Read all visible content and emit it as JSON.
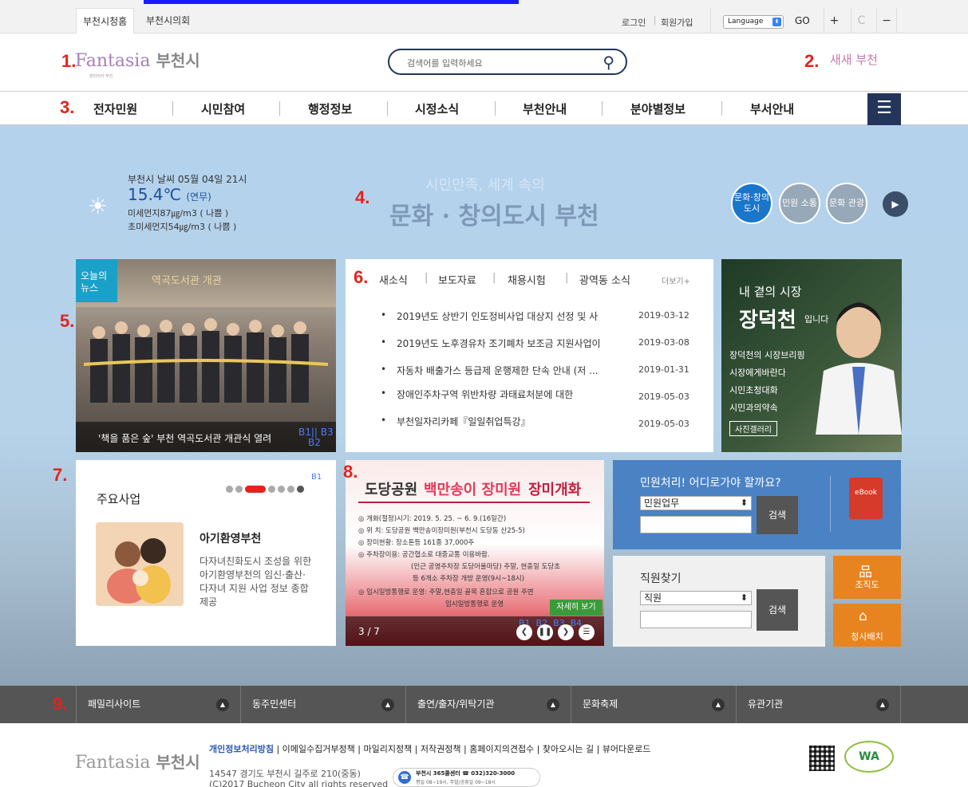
{
  "topbar": {
    "tabs": [
      "부천시청홈",
      "부천시의회"
    ],
    "login": "로그인",
    "signup": "회원가입",
    "language": "Language",
    "go": "GO",
    "zoom_in": "+",
    "reset": "C",
    "zoom_out": "−"
  },
  "markers": [
    "1.",
    "2.",
    "3.",
    "4.",
    "5.",
    "6.",
    "7.",
    "8.",
    "9."
  ],
  "header": {
    "logo": "Fantasia",
    "logo_city": "부천시",
    "logo_sub": "판타지아 부천",
    "search_placeholder": "검색어를 입력하세요",
    "slogan": "새새 부천"
  },
  "gnb": [
    "전자민원",
    "시민참여",
    "행정정보",
    "시정소식",
    "부천안내",
    "분야별정보",
    "부서안내"
  ],
  "weather": {
    "title": "부천시 날씨 05월 04일 21시",
    "temp": "15.4℃",
    "cond": "(연무)",
    "pm10": "미세먼지87㎍/m3 ( 나쁨 )",
    "pm25": "초미세먼지54㎍/m3 ( 나쁨 )"
  },
  "hero": {
    "slogan_small": "시민만족, 세계 속의",
    "slogan_big": "문화 · 창의도시 부천",
    "circles": [
      "문화·창의 도시",
      "민원 소통",
      "문화 관광"
    ]
  },
  "news_photo": {
    "badge": "오늘의 뉴스",
    "sign": "역곡도서관 개관",
    "caption": "'책을 품은 숲' 부천 역곡도서관 개관식 열려",
    "buttons": "B1|| B3",
    "buttons2": "B2"
  },
  "news_list": {
    "tabs": [
      "새소식",
      "보도자료",
      "채용시험",
      "광역동 소식"
    ],
    "more": "더보기+",
    "items": [
      {
        "title": "2019년도 상반기 인도정비사업 대상지 선정 및 사",
        "date": "2019-03-12"
      },
      {
        "title": "2019년도 노후경유차 조기폐차 보조금 지원사업이",
        "date": "2019-03-08"
      },
      {
        "title": "자동차 배출가스 등급제 운행제한 단속 안내 (저 ...",
        "date": "2019-01-31"
      },
      {
        "title": "장애인주차구역 위반차량 과태료처분에 대한",
        "date": "2019-05-03"
      },
      {
        "title": "부천일자리카페『일일취업특강』",
        "date": "2019-05-03"
      }
    ]
  },
  "mayor": {
    "line1": "내 곁의 시장",
    "line2": "장덕천",
    "line2b": "입니다",
    "links": [
      "장덕천의 시장브리핑",
      "시장에게바란다",
      "시민초청대화",
      "시민과의약속"
    ],
    "gallery": "사진갤러리"
  },
  "business": {
    "title": "주요사업",
    "sub": "아기환영부천",
    "desc": [
      "다자녀친화도시 조성을 위한",
      "아기환영부천의 임신·출산·",
      "다자녀 지원 사업 정보 종합",
      "제공"
    ],
    "label": "B1"
  },
  "rose": {
    "title": "도당공원",
    "title2": "백만송이 장미원",
    "title3": "장미개화",
    "lines": [
      "◎ 개화(절정)시기: 2019. 5. 25. ~ 6. 9.(16일간)",
      "◎ 위 치: 도당공원 백만송이장미원(부천시 도당동 산25-5)",
      "◎ 장미현황: 장소톤등 161종 37,000주",
      "◎ 주차장이용: 공간협소로 대중교통 이용바람.",
      "(인근 공영주차장 도당어울마당) 주말, 현충일 도당초",
      "등 6개소 주차장 개방 운영(9시~18시)",
      "◎ 임시일방통행로 운영: 주말,현충일 골목 혼잡으로 공원 주변",
      "임시일방통행로 운영"
    ],
    "detail": "자세히 보기",
    "page": "3 / 7",
    "blabels": "B1  B2  B3  B4"
  },
  "civil": {
    "title": "민원처리! 어디로가야 할까요?",
    "select": "민원업무",
    "btn": "검색",
    "ebook": "eBook"
  },
  "staff": {
    "title": "직원찾기",
    "select": "직원",
    "btn": "검색",
    "org": "조직도",
    "office": "청사배치"
  },
  "footbar": [
    "패밀리사이트",
    "동주민센터",
    "출연/출자/위탁기관",
    "문화축제",
    "유관기관"
  ],
  "footer": {
    "links": [
      "개인정보처리방침",
      "이메일수집거부정책",
      "마일리지정책",
      "저작권정책",
      "홈페이지의견접수",
      "찾아오시는 길",
      "뷰어다운로드"
    ],
    "address": "14547 경기도 부천시 길주로 210(중동)",
    "copyright": "(C)2017 Bucheon City all rights reserved",
    "callcenter": "부천시 365콜센터 ☎ 032)320-3000",
    "callhours": "평일 08~19시, 주말/공휴일 09~18시",
    "wa": "WA"
  },
  "colors": {
    "navy": "#23355b",
    "red": "#e4231b",
    "teal": "#1aa1c8",
    "civil_blue": "#4a82c4",
    "orange": "#e8841f"
  }
}
